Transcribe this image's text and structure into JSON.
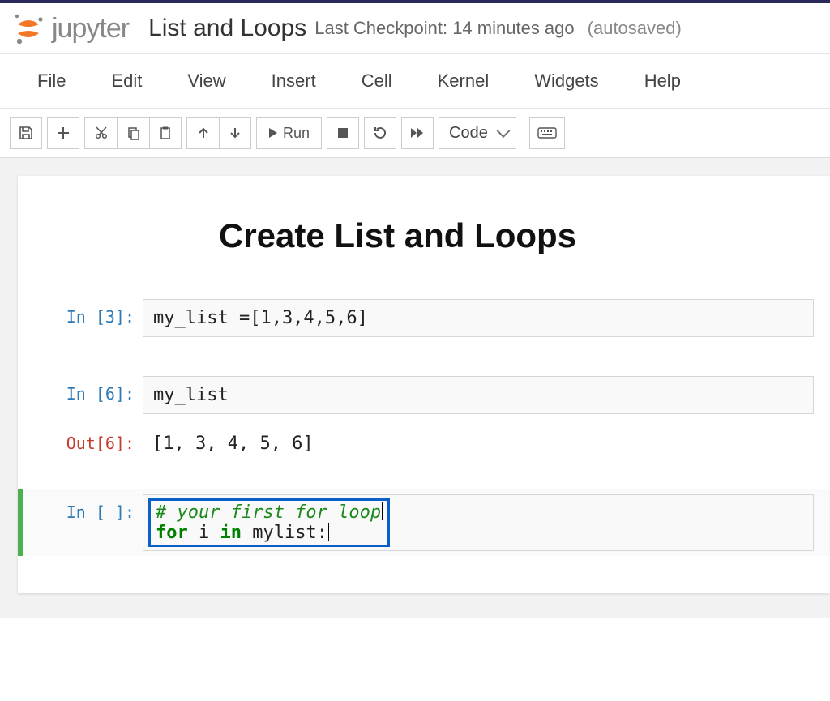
{
  "header": {
    "logo_text": "jupyter",
    "notebook_name": "List and Loops",
    "checkpoint_text": "Last Checkpoint: 14 minutes ago",
    "autosaved_text": "(autosaved)"
  },
  "menubar": [
    "File",
    "Edit",
    "View",
    "Insert",
    "Cell",
    "Kernel",
    "Widgets",
    "Help"
  ],
  "toolbar": {
    "run_label": "Run",
    "celltype": "Code"
  },
  "notebook": {
    "markdown_title": "Create List and Loops",
    "cells": [
      {
        "prompt_in": "In [3]:",
        "code_plain": "my_list =[1,3,4,5,6]"
      },
      {
        "prompt_in": "In [6]:",
        "code_plain": "my_list",
        "prompt_out": "Out[6]:",
        "output": "[1, 3, 4, 5, 6]"
      },
      {
        "prompt_in": "In [ ]:",
        "code_comment": "# your first for loop",
        "code_line2_kw1": "for",
        "code_line2_mid": " i ",
        "code_line2_kw2": "in",
        "code_line2_tail": " mylist:"
      }
    ]
  }
}
